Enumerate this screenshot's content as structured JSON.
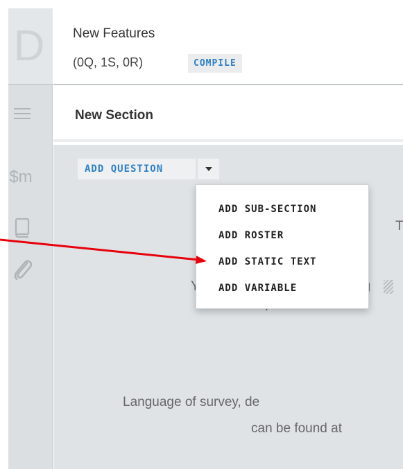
{
  "sidebar": {
    "logo_letter": "D",
    "macro_label": "$m",
    "icons": [
      "menu-icon",
      "macros-icon",
      "book-icon",
      "paperclip-icon"
    ]
  },
  "header": {
    "title": "New Features",
    "stats": "(0Q, 1S, 0R)",
    "compile_label": "COMPILE"
  },
  "section": {
    "title": "New Section"
  },
  "toolbar": {
    "add_question_label": "ADD QUESTION"
  },
  "dropdown": {
    "items": [
      "ADD SUB-SECTION",
      "ADD ROSTER",
      "ADD STATIC TEXT",
      "ADD VARIABLE"
    ]
  },
  "hints": {
    "line1_partial": "T",
    "line2_start": "Y",
    "line2_end": "ng",
    "line3": "on top of this block",
    "line4": "Language of survey, de",
    "line5": "can be found at"
  },
  "colors": {
    "accent_blue": "#2f7fc6",
    "annotation_red": "#e8000b",
    "content_bg": "#dfe3e6",
    "sidebar_bg": "#dbdfe2"
  }
}
